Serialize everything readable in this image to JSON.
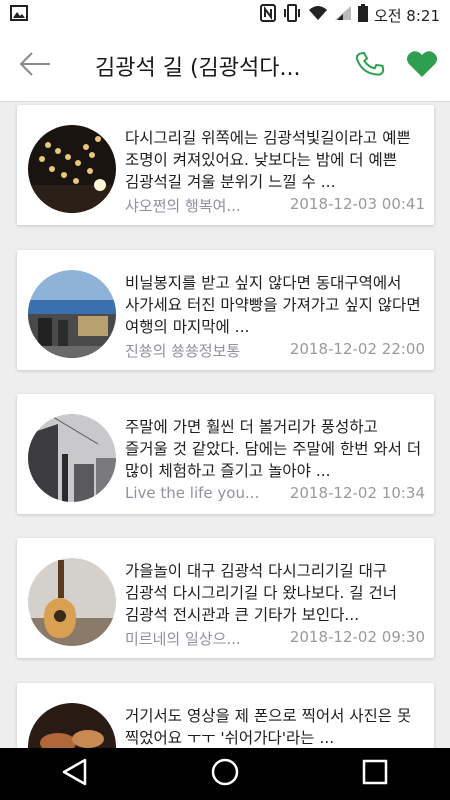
{
  "status_bar": {
    "time": "오전 8:21",
    "icons": [
      "image-icon",
      "nfc-icon",
      "vibrate-icon",
      "wifi-icon",
      "signal-icon",
      "battery-icon"
    ]
  },
  "app_bar": {
    "title": "김광석 길 (김광석다...",
    "icons": [
      "back-arrow-icon",
      "phone-icon",
      "heart-icon"
    ],
    "accent_color": "#2e9e4f"
  },
  "posts": [
    {
      "text": "다시그리길 위쪽에는 김광석빛길이라고 예쁜 조명이 켜져있어요. 낮보다는 밤에 더 예쁜 김광석길 겨울 분위기 느낄 수 ...",
      "author": "샤오쩐의 행복여...",
      "date": "2018-12-03 00:41",
      "thumb": "night-lights"
    },
    {
      "text": "비닐봉지를 받고 싶지 않다면 동대구역에서 사가세요 터진 마약빵을 가져가고 싶지 않다면 여행의 마지막에 ...",
      "author": "진쑝의 쑝쑝정보통",
      "date": "2018-12-02 22:00",
      "thumb": "shop-front"
    },
    {
      "text": "주말에 가면 훨씬 더 볼거리가 풍성하고 즐거울 것 같았다. 담에는 주말에 한번 와서 더 많이 체험하고 즐기고 놀아야 ...",
      "author": "Live the life you...",
      "date": "2018-12-02 10:34",
      "thumb": "alley-sky"
    },
    {
      "text": "가을놀이 대구 김광석 다시그리기길 대구 김광석 다시그리기길 다 왔나보다. 길 건너 김광석 전시관과 큰 기타가 보인다...",
      "author": "미르네의 일상으...",
      "date": "2018-12-02 09:30",
      "thumb": "guitar"
    },
    {
      "text": "거기서도 영상을 제 폰으로 찍어서 사진은 못 찍었어요 ㅜㅜ '쉬어가다'라는 ...",
      "author": "",
      "date": "",
      "thumb": "food"
    }
  ]
}
